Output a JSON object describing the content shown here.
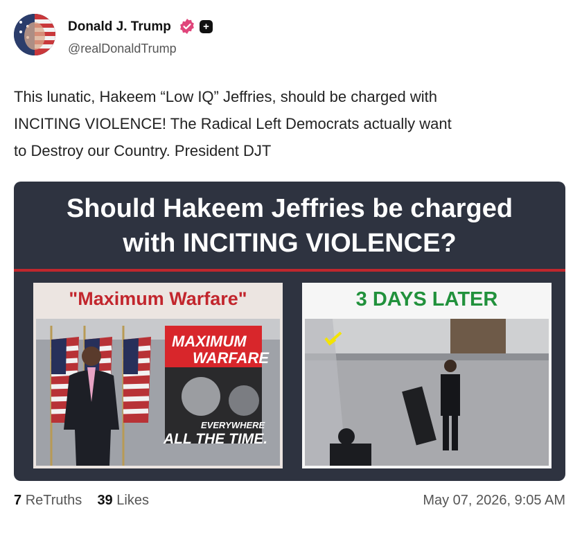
{
  "author": {
    "display_name": "Donald J. Trump",
    "handle": "@realDonaldTrump"
  },
  "post": {
    "text": "This lunatic, Hakeem “Low IQ” Jeffries, should be charged with\nINCITING VIOLENCE! The Radical Left Democrats actually want\nto Destroy our Country. President DJT"
  },
  "card": {
    "headline_line1": "Should Hakeem Jeffries be charged",
    "headline_line2": "with INCITING VIOLENCE?",
    "left_caption": "\"Maximum Warfare\"",
    "right_caption": "3 DAYS LATER",
    "sign_line1": "MAXIMUM",
    "sign_line2": "WARFARE",
    "sign_line3": "EVERYWHERE",
    "sign_line4": "ALL THE TIME."
  },
  "footer": {
    "retruths_count": "7",
    "retruths_label": "ReTruths",
    "likes_count": "39",
    "likes_label": "Likes",
    "timestamp": "May 07, 2026, 9:05 AM"
  },
  "colors": {
    "card_background": "#2e3340",
    "divider_red": "#c0272d",
    "left_caption_red": "#c2262d",
    "right_caption_green": "#21913c",
    "verified_pink": "#e0457b"
  },
  "icons": {
    "verified": "verified-badge-icon",
    "plus": "plus-badge-icon"
  }
}
